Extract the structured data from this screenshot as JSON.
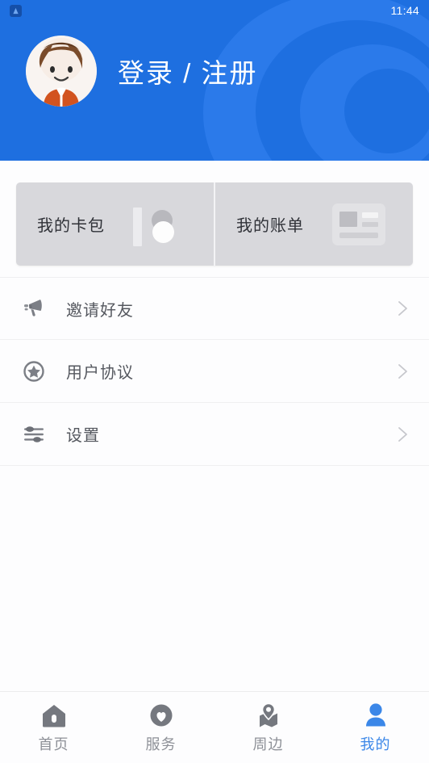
{
  "status_bar": {
    "app_icon": "app-notification-icon",
    "time": "11:44"
  },
  "header": {
    "avatar_icon": "user-avatar",
    "login_label": "登录 / 注册",
    "background_color": "#1e6fe0",
    "accent_color": "#2b7aea",
    "decoration": "spiral-swirl"
  },
  "quick_cards": [
    {
      "label": "我的卡包",
      "icon": "wallet-card-icon"
    },
    {
      "label": "我的账单",
      "icon": "bill-document-icon"
    }
  ],
  "menu": [
    {
      "label": "邀请好友",
      "icon": "megaphone-icon",
      "chevron": "chevron-right-icon"
    },
    {
      "label": "用户协议",
      "icon": "star-circle-icon",
      "chevron": "chevron-right-icon"
    },
    {
      "label": "设置",
      "icon": "sliders-icon",
      "chevron": "chevron-right-icon"
    }
  ],
  "tabbar": {
    "active_color": "#3b87e8",
    "inactive_color": "#8d9097",
    "tabs": [
      {
        "label": "首页",
        "icon": "home-icon",
        "active": false
      },
      {
        "label": "服务",
        "icon": "heart-circle-icon",
        "active": false
      },
      {
        "label": "周边",
        "icon": "map-pin-icon",
        "active": false
      },
      {
        "label": "我的",
        "icon": "person-icon",
        "active": true
      }
    ]
  }
}
